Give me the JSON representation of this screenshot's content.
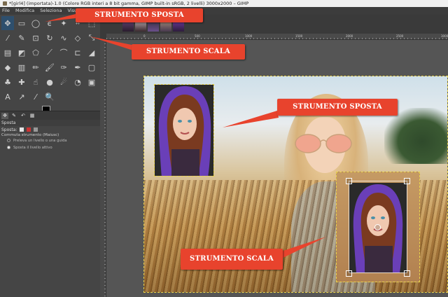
{
  "window": {
    "title": "*[girl4] (importata)-1.0 (Colore RGB interi a 8 bit gamma, GIMP built-in sRGB, 2 livelli) 3000x2000 – GIMP"
  },
  "menubar": {
    "items": [
      "File",
      "Modifica",
      "Seleziona",
      "Visualizza",
      "Im"
    ]
  },
  "toolbox": {
    "tools": [
      {
        "icon": "move-tool-icon",
        "glyph": "✥",
        "selected": true
      },
      {
        "icon": "rect-select-icon",
        "glyph": "▭"
      },
      {
        "icon": "ellipse-select-icon",
        "glyph": "◯"
      },
      {
        "icon": "lasso-icon",
        "glyph": "ϵ"
      },
      {
        "icon": "fuzzy-select-icon",
        "glyph": "✦"
      },
      {
        "icon": "crop-icon",
        "glyph": "⌗"
      },
      {
        "icon": "unified-transform-icon",
        "glyph": "⬚"
      },
      {
        "icon": "wand-icon",
        "glyph": "⁄"
      },
      {
        "icon": "color-picker-icon",
        "glyph": "✎"
      },
      {
        "icon": "crop-tool-icon",
        "glyph": "⊡"
      },
      {
        "icon": "rotate-icon",
        "glyph": "↻"
      },
      {
        "icon": "warp-icon",
        "glyph": "∿"
      },
      {
        "icon": "handle-transform-icon",
        "glyph": "◇"
      },
      {
        "icon": "scale-tool-icon",
        "glyph": "⤡"
      },
      {
        "icon": "align-icon",
        "glyph": "▤"
      },
      {
        "icon": "flip-icon",
        "glyph": "◩"
      },
      {
        "icon": "cage-icon",
        "glyph": "⬠"
      },
      {
        "icon": "perspective-icon",
        "glyph": "⟋"
      },
      {
        "icon": "paths-icon",
        "glyph": "⌒"
      },
      {
        "icon": "text-tool-icon",
        "glyph": "⊏"
      },
      {
        "icon": "eraser-icon",
        "glyph": "◢"
      },
      {
        "icon": "paint-bucket-icon",
        "glyph": "◆"
      },
      {
        "icon": "gradient-icon",
        "glyph": "▥"
      },
      {
        "icon": "pencil-icon",
        "glyph": "✏"
      },
      {
        "icon": "paintbrush-icon",
        "glyph": "🖌"
      },
      {
        "icon": "airbrush-icon",
        "glyph": "✑"
      },
      {
        "icon": "ink-icon",
        "glyph": "✒"
      },
      {
        "icon": "mypaint-icon",
        "glyph": "▢"
      },
      {
        "icon": "clone-icon",
        "glyph": "♣"
      },
      {
        "icon": "heal-icon",
        "glyph": "✚"
      },
      {
        "icon": "smudge-icon",
        "glyph": "☝"
      },
      {
        "icon": "blur-icon",
        "glyph": "●"
      },
      {
        "icon": "dodge-burn-icon",
        "glyph": "☄"
      },
      {
        "icon": "measure-icon",
        "glyph": "◔"
      },
      {
        "icon": "zoom-icon",
        "glyph": "▣"
      },
      {
        "icon": "text-A-icon",
        "glyph": "A"
      },
      {
        "icon": "path-pen-icon",
        "glyph": "↗"
      },
      {
        "icon": "eyedropper-icon",
        "glyph": "⁄"
      },
      {
        "icon": "magnify-icon",
        "glyph": "🔍"
      }
    ],
    "panel_tabs": [
      "tool-options-tab",
      "device-status-tab",
      "undo-history-tab",
      "images-tab"
    ],
    "panel_title": "Sposta",
    "options_label": "Sposta:",
    "switch_label": "Commuta strumento (Maiusc)",
    "radio_pick": "Preleva un livello o una guida",
    "radio_active": "Sposta il livello attivo"
  },
  "ruler": {
    "ticks": [
      "0",
      "500",
      "1000",
      "1500",
      "2000",
      "2500",
      "3000"
    ]
  },
  "callouts": {
    "top_move": "STRUMENTO SPOSTA",
    "top_scale": "STRUMENTO SCALA",
    "canvas_move": "STRUMENTO SPOSTA",
    "canvas_scale": "STRUMENTO SCALA"
  },
  "colors": {
    "callout_red": "#e8432d",
    "selection_dash": "#e8d24a",
    "purple_scarf": "#6a3fb8"
  }
}
